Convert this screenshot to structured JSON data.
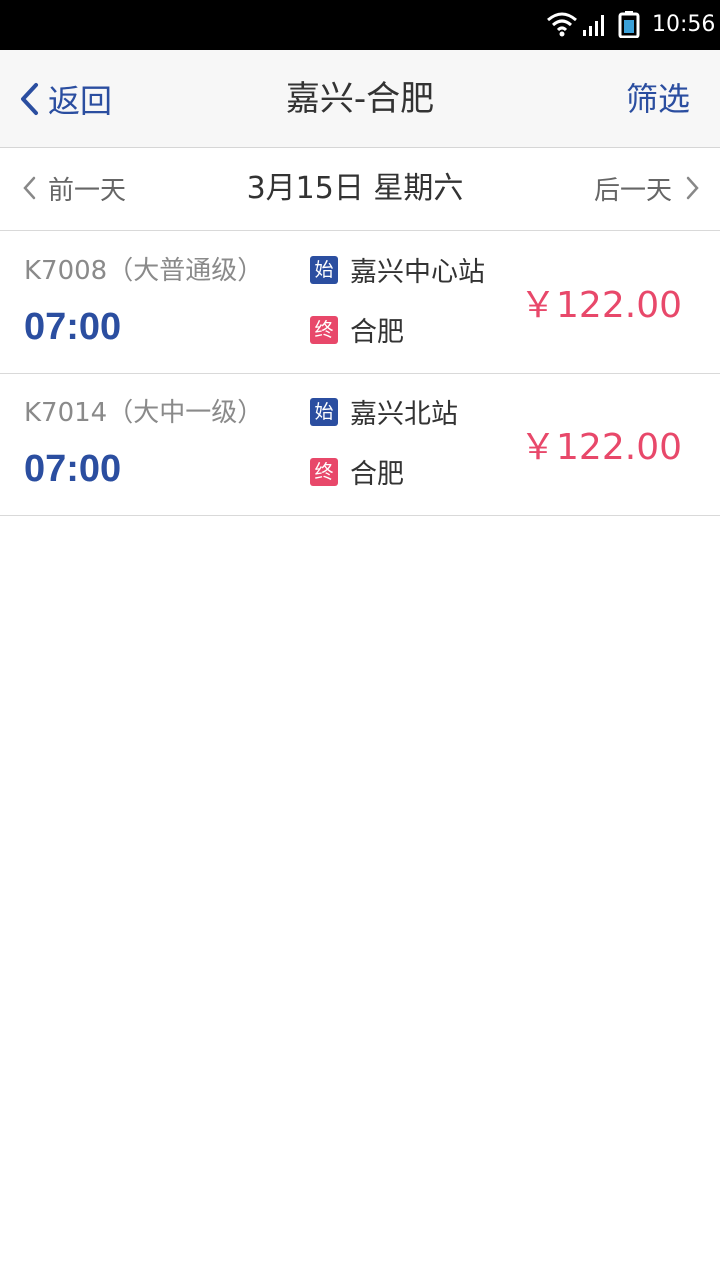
{
  "status_bar": {
    "time": "10:56",
    "icons": [
      "wifi-icon",
      "cell-signal-icon",
      "battery-icon"
    ]
  },
  "header": {
    "back_label": "返回",
    "title": "嘉兴-合肥",
    "filter_label": "筛选",
    "accent_color": "#2b4ea0"
  },
  "date_nav": {
    "prev_label": "前一天",
    "date": "3月15日 星期六",
    "next_label": "后一天"
  },
  "trains": [
    {
      "code": "K7008（大普通级）",
      "time": "07:00",
      "start_badge": "始",
      "start_station": "嘉兴中心站",
      "end_badge": "终",
      "end_station": "合肥",
      "price": "￥122.00"
    },
    {
      "code": "K7014（大中一级）",
      "time": "07:00",
      "start_badge": "始",
      "start_station": "嘉兴北站",
      "end_badge": "终",
      "end_station": "合肥",
      "price": "￥122.00"
    }
  ],
  "colors": {
    "price": "#e8486a",
    "start_badge": "#2b4ea0",
    "end_badge": "#e8486a"
  }
}
